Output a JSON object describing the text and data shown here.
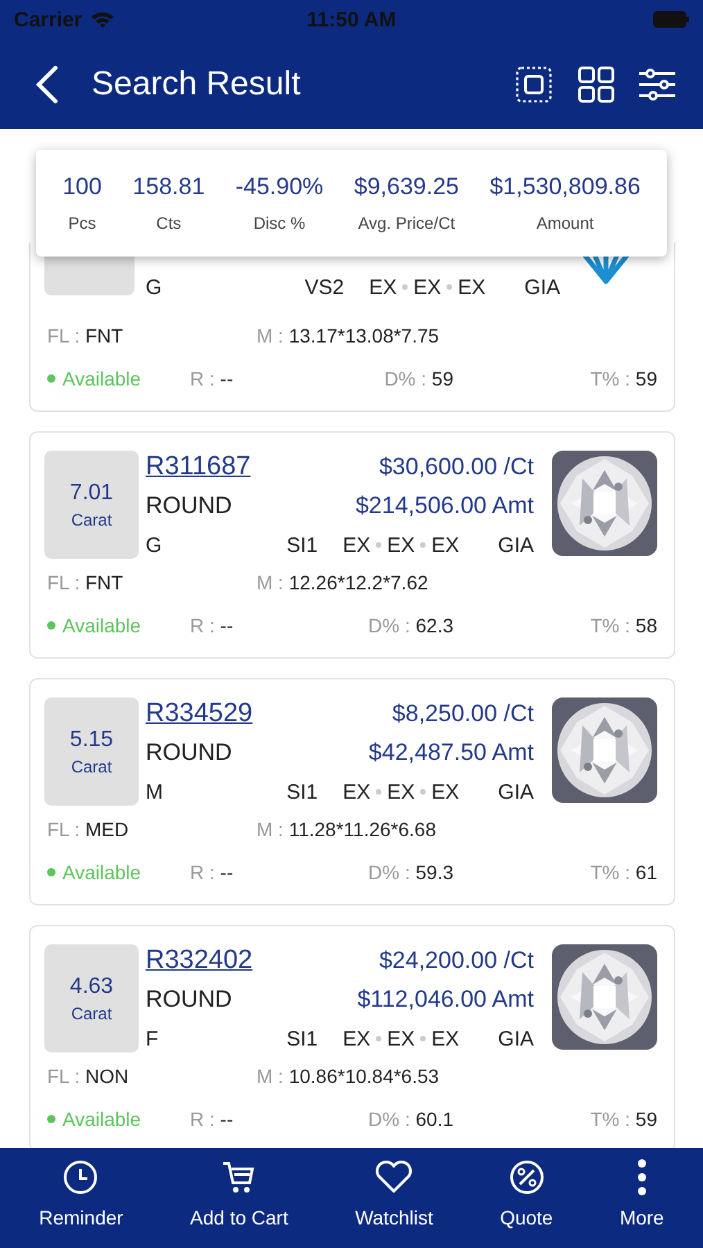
{
  "status_bar": {
    "carrier": "Carrier",
    "time": "11:50 AM"
  },
  "header": {
    "title": "Search Result"
  },
  "summary": [
    {
      "value": "100",
      "label": "Pcs"
    },
    {
      "value": "158.81",
      "label": "Cts"
    },
    {
      "value": "-45.90%",
      "label": "Disc %"
    },
    {
      "value": "$9,639.25",
      "label": "Avg. Price/Ct"
    },
    {
      "value": "$1,530,809.86",
      "label": "Amount"
    }
  ],
  "stones": [
    {
      "kind": "partial",
      "gem_color": "G",
      "clarity": "VS2",
      "cut": "EX",
      "polish": "EX",
      "symmetry": "EX",
      "lab": "GIA",
      "fl_label": "FL :",
      "fl": "FNT",
      "m_label": "M :",
      "measurements": "13.17*13.08*7.75",
      "status": "Available",
      "r_label": "R :",
      "r": "--",
      "d_label": "D% :",
      "depth": "59",
      "t_label": "T% :",
      "table": "59"
    },
    {
      "kind": "full",
      "carat": "7.01",
      "carat_unit": "Carat",
      "stone_id": "R311687",
      "price_per_ct": "$30,600.00 /Ct",
      "shape": "ROUND",
      "amount": "$214,506.00 Amt",
      "gem_color": "G",
      "clarity": "SI1",
      "cut": "EX",
      "polish": "EX",
      "symmetry": "EX",
      "lab": "GIA",
      "fl_label": "FL :",
      "fl": "FNT",
      "m_label": "M :",
      "measurements": "12.26*12.2*7.62",
      "status": "Available",
      "r_label": "R :",
      "r": "--",
      "d_label": "D% :",
      "depth": "62.3",
      "t_label": "T% :",
      "table": "58"
    },
    {
      "kind": "full",
      "carat": "5.15",
      "carat_unit": "Carat",
      "stone_id": "R334529",
      "price_per_ct": "$8,250.00 /Ct",
      "shape": "ROUND",
      "amount": "$42,487.50 Amt",
      "gem_color": "M",
      "clarity": "SI1",
      "cut": "EX",
      "polish": "EX",
      "symmetry": "EX",
      "lab": "GIA",
      "fl_label": "FL :",
      "fl": "MED",
      "m_label": "M :",
      "measurements": "11.28*11.26*6.68",
      "status": "Available",
      "r_label": "R :",
      "r": "--",
      "d_label": "D% :",
      "depth": "59.3",
      "t_label": "T% :",
      "table": "61"
    },
    {
      "kind": "full",
      "carat": "4.63",
      "carat_unit": "Carat",
      "stone_id": "R332402",
      "price_per_ct": "$24,200.00 /Ct",
      "shape": "ROUND",
      "amount": "$112,046.00 Amt",
      "gem_color": "F",
      "clarity": "SI1",
      "cut": "EX",
      "polish": "EX",
      "symmetry": "EX",
      "lab": "GIA",
      "fl_label": "FL :",
      "fl": "NON",
      "m_label": "M :",
      "measurements": "10.86*10.84*6.53",
      "status": "Available",
      "r_label": "R :",
      "r": "--",
      "d_label": "D% :",
      "depth": "60.1",
      "t_label": "T% :",
      "table": "59"
    }
  ],
  "bottom_nav": [
    {
      "kind": "clock",
      "label": "Reminder"
    },
    {
      "kind": "cart",
      "label": "Add to Cart"
    },
    {
      "kind": "heart",
      "label": "Watchlist"
    },
    {
      "kind": "percent",
      "label": "Quote"
    },
    {
      "kind": "more",
      "label": "More"
    }
  ]
}
